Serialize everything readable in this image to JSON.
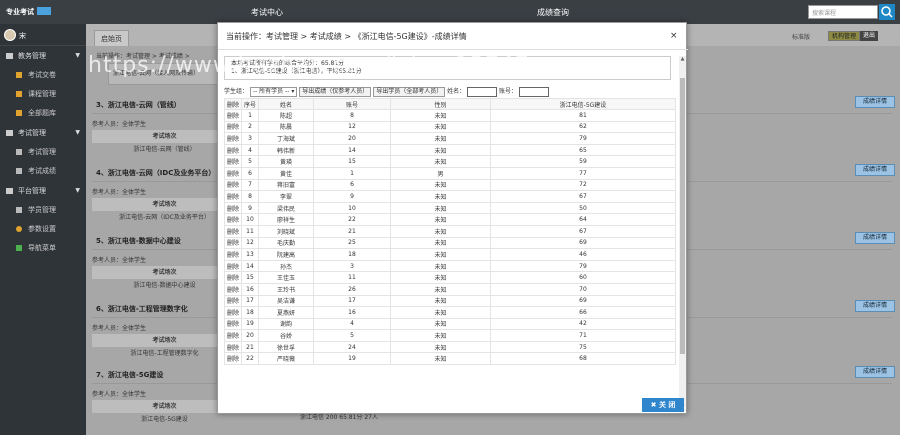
{
  "topbar": {
    "logo_text": "专业考试",
    "nav": [
      "考试中心",
      "成绩查询"
    ],
    "search_placeholder": "搜索课程"
  },
  "header": {
    "home_tab": "启始页",
    "links": "标准版",
    "org_button": "机构管理",
    "exit_button": "退出"
  },
  "sidebar": {
    "username": "宋",
    "categories": [
      {
        "label": "教务管理",
        "items": [
          "考试交卷",
          "课程管理",
          "全部题库"
        ]
      },
      {
        "label": "考试管理",
        "items": [
          "考试管理",
          "考试成绩"
        ]
      },
      {
        "label": "平台管理",
        "items": [
          "学员管理",
          "参数设置",
          "导航菜单"
        ]
      }
    ]
  },
  "breadcrumb": {
    "path": "当前操作：考试管理 > 考试成绩 >",
    "box_text": "浙江电信-云网（接入网及传输）"
  },
  "exams": [
    {
      "title": "3、浙江电信-云网（管线）",
      "people": "参考人员：全体学生",
      "th": "考试场次",
      "td": "浙江电信-云网（管线）",
      "btn": "成绩详情"
    },
    {
      "title": "4、浙江电信-云网（IDC及业务平台）",
      "people": "参考人员：全体学生",
      "th": "考试场次",
      "td": "浙江电信-云网（IDC及业务平台）",
      "btn": "成绩详情"
    },
    {
      "title": "5、浙江电信-数据中心建设",
      "people": "参考人员：全体学生",
      "th": "考试场次",
      "td": "浙江电信-数据中心建设",
      "btn": "成绩详情"
    },
    {
      "title": "6、浙江电信-工程管理数字化",
      "people": "参考人员：全体学生",
      "th": "考试场次",
      "td": "浙江电信-工程管理数字化",
      "btn": "成绩详情"
    },
    {
      "title": "7、浙江电信-5G建设",
      "people": "参考人员：全体学生",
      "th": "考试场次",
      "td": "浙江电信-5G建设",
      "btn": "成绩详情"
    }
  ],
  "bottom_row": "浙江电信     200    65.81分    27人",
  "modal": {
    "title": "当前操作：考试管理 > 考试成绩 > 《浙江电信-5G建设》-成绩详情",
    "close_x": "×",
    "summary_line1": "本场考试所有学员的综合平均分：65.81分",
    "summary_line2": "1、浙江电信-5G建设（浙江电信），平均65.81分",
    "filter_group_label": "学生组：",
    "filter_group_value": "-- 所有学员 --",
    "export_pass": "导出成绩（仅参考人员）",
    "export_all": "导出学员（全部考人员）",
    "name_label": "姓名：",
    "account_label": "账号：",
    "columns": [
      "删除",
      "序号",
      "姓名",
      "账号",
      "性别",
      "浙江电信-5G建设"
    ],
    "rows": [
      [
        "删除",
        "1",
        "陈超",
        "8",
        "未知",
        "81"
      ],
      [
        "删除",
        "2",
        "陈晨",
        "12",
        "未知",
        "62"
      ],
      [
        "删除",
        "3",
        "丁海斌",
        "20",
        "未知",
        "79"
      ],
      [
        "删除",
        "4",
        "韩伟新",
        "14",
        "未知",
        "65"
      ],
      [
        "删除",
        "5",
        "黄瑛",
        "15",
        "未知",
        "59"
      ],
      [
        "删除",
        "6",
        "黄佳",
        "1",
        "男",
        "77"
      ],
      [
        "删除",
        "7",
        "蒋旧富",
        "6",
        "未知",
        "72"
      ],
      [
        "删除",
        "8",
        "李翠",
        "9",
        "未知",
        "67"
      ],
      [
        "删除",
        "9",
        "梁伟民",
        "10",
        "未知",
        "50"
      ],
      [
        "删除",
        "10",
        "廖祥生",
        "22",
        "未知",
        "64"
      ],
      [
        "删除",
        "11",
        "刘晓斌",
        "21",
        "未知",
        "67"
      ],
      [
        "删除",
        "12",
        "毛庆勤",
        "25",
        "未知",
        "69"
      ],
      [
        "删除",
        "13",
        "阮建高",
        "18",
        "未知",
        "46"
      ],
      [
        "删除",
        "14",
        "孙杰",
        "3",
        "未知",
        "79"
      ],
      [
        "删除",
        "15",
        "王佳玉",
        "11",
        "未知",
        "60"
      ],
      [
        "删除",
        "16",
        "王玲书",
        "26",
        "未知",
        "70"
      ],
      [
        "删除",
        "17",
        "吴洁谦",
        "17",
        "未知",
        "69"
      ],
      [
        "删除",
        "18",
        "夏燕妍",
        "16",
        "未知",
        "66"
      ],
      [
        "删除",
        "19",
        "谢韵",
        "4",
        "未知",
        "42"
      ],
      [
        "删除",
        "20",
        "谷娇",
        "5",
        "未知",
        "71"
      ],
      [
        "删除",
        "21",
        "徐世孚",
        "24",
        "未知",
        "75"
      ],
      [
        "删除",
        "22",
        "严晓薇",
        "19",
        "未知",
        "68"
      ]
    ],
    "close_button": "关 闭"
  },
  "watermark": "https://www.huzhan.com/ishop12747",
  "colors": {
    "topbar": "#3a3f44",
    "sidebar": "#2f3439",
    "overlay": "#a7a7a7",
    "primary_button": "#2f86cd",
    "grade_button": "#9cc3e3"
  }
}
